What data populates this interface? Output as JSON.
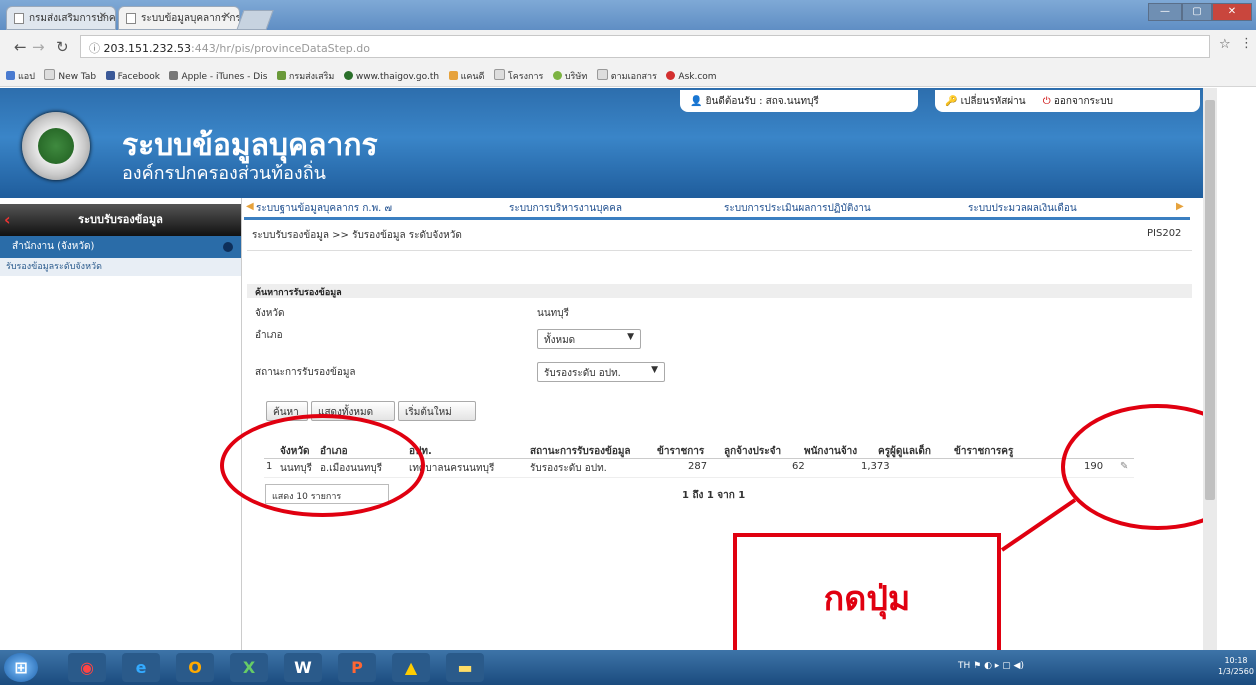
{
  "browser": {
    "tabs": [
      {
        "label": "กรมส่งเสริมการปกครองท้องถิ่น",
        "active": false
      },
      {
        "label": "ระบบข้อมูลบุคลากร กรมส่งเสริม",
        "active": true
      }
    ],
    "url_host": "203.151.232.53",
    "url_path": ":443/hr/pis/provinceDataStep.do",
    "bookmarks": [
      "แอป",
      "New Tab",
      "Facebook",
      "Apple - iTunes - Dis",
      "กรมส่งเสริม",
      "www.thaigov.go.th",
      "แคนดี",
      "โครงการ",
      "บริษัท",
      "ตามเอกสาร",
      "Ask.com"
    ]
  },
  "site": {
    "title": "ระบบข้อมูลบุคลากร",
    "subtitle": "องค์กรปกครองส่วนท้องถิ่น",
    "user_label": "ยินดีต้อนรับ : สถจ.นนทบุรี",
    "change_password": "เปลี่ยนรหัสผ่าน",
    "logout": "ออกจากระบบ"
  },
  "sidebar": {
    "header": "ระบบรับรองข้อมูล",
    "section": "สำนักงาน (จังหวัด)",
    "item": "รับรองข้อมูลระดับจังหวัด"
  },
  "menu": [
    "ระบบฐานข้อมูลบุคลากร ก.พ. ๗",
    "ระบบการบริหารงานบุคคล",
    "ระบบการประเมินผลการปฏิบัติงาน",
    "ระบบประมวลผลเงินเดือน"
  ],
  "breadcrumb": "ระบบรับรองข้อมูล >> รับรองข้อมูล ระดับจังหวัด",
  "page_code": "PIS202",
  "form": {
    "heading": "ค้นหาการรับรองข้อมูล",
    "province_label": "จังหวัด",
    "province_value": "นนทบุรี",
    "district_label": "อำเภอ",
    "district_value": "ทั้งหมด",
    "status_label": "สถานะการรับรองข้อมูล",
    "status_value": "รับรองระดับ อปท."
  },
  "buttons": {
    "search": "ค้นหา",
    "show_all": "แสดงทั้งหมด",
    "reset": "เริ่มต้นใหม่"
  },
  "table": {
    "headers": [
      "จังหวัด",
      "อำเภอ",
      "อปท.",
      "สถานะการรับรองข้อมูล",
      "ข้าราชการ",
      "ลูกจ้างประจำ",
      "พนักงานจ้าง",
      "ครูผู้ดูแลเด็ก",
      "ข้าราชการครู"
    ],
    "row": {
      "no": "1",
      "province": "นนทบุรี",
      "district": "อ.เมืองนนทบุรี",
      "org": "เทศบาลนครนนทบุรี",
      "status": "รับรองระดับ อปท.",
      "officials": "287",
      "permanent": "62",
      "contract": "1,373",
      "caregivers": "",
      "teachers": "190"
    },
    "pager": "1 ถึง 1 จาก 1",
    "per_page": "แสดง 10 รายการ"
  },
  "annotation": {
    "callout": "กดปุ่ม"
  },
  "taskbar": {
    "lang": "TH",
    "time": "10:18",
    "date": "1/3/2560"
  },
  "colors": {
    "header": "#2d6ead",
    "accent": "#3b7fc1",
    "annotation": "#e00010"
  }
}
